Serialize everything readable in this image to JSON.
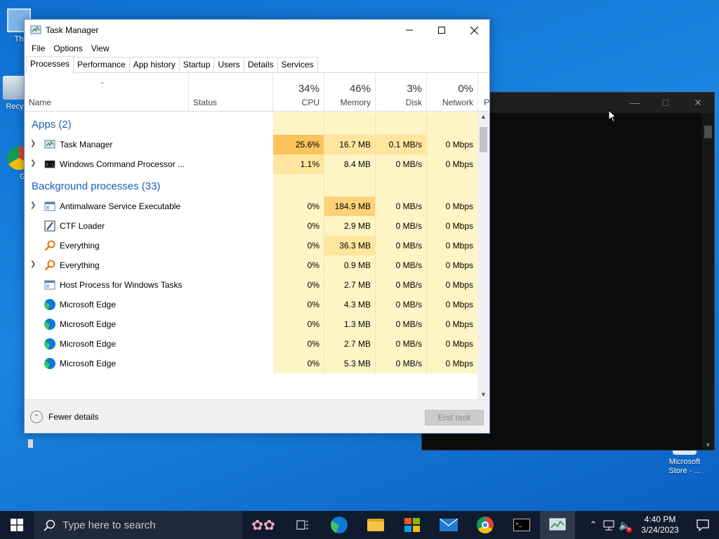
{
  "desktop": {
    "icons": [
      {
        "label": "Th"
      },
      {
        "label": "Recy"
      },
      {
        "label": "Go Ch"
      },
      {
        "label": "Microsoft Store - ..."
      }
    ]
  },
  "task_manager": {
    "title": "Task Manager",
    "menu": [
      "File",
      "Options",
      "View"
    ],
    "tabs": [
      "Processes",
      "Performance",
      "App history",
      "Startup",
      "Users",
      "Details",
      "Services"
    ],
    "active_tab": "Processes",
    "columns": {
      "name": "Name",
      "status": "Status",
      "cpu": {
        "pct": "34%",
        "label": "CPU"
      },
      "memory": {
        "pct": "46%",
        "label": "Memory"
      },
      "disk": {
        "pct": "3%",
        "label": "Disk"
      },
      "network": {
        "pct": "0%",
        "label": "Network"
      },
      "power_partial": "P"
    },
    "groups": {
      "apps": "Apps (2)",
      "background": "Background processes (33)"
    },
    "apps": [
      {
        "name": "Task Manager",
        "cpu": "25.6%",
        "memory": "16.7 MB",
        "disk": "0.1 MB/s",
        "network": "0 Mbps",
        "expandable": true,
        "icon": "task-manager-icon"
      },
      {
        "name": "Windows Command Processor ...",
        "cpu": "1.1%",
        "memory": "8.4 MB",
        "disk": "0 MB/s",
        "network": "0 Mbps",
        "expandable": true,
        "icon": "cmd-icon"
      }
    ],
    "background": [
      {
        "name": "Antimalware Service Executable",
        "cpu": "0%",
        "memory": "184.9 MB",
        "disk": "0 MB/s",
        "network": "0 Mbps",
        "expandable": true,
        "icon": "service-window-icon"
      },
      {
        "name": "CTF Loader",
        "cpu": "0%",
        "memory": "2.9 MB",
        "disk": "0 MB/s",
        "network": "0 Mbps",
        "expandable": false,
        "icon": "ctf-loader-icon"
      },
      {
        "name": "Everything",
        "cpu": "0%",
        "memory": "36.3 MB",
        "disk": "0 MB/s",
        "network": "0 Mbps",
        "expandable": false,
        "icon": "everything-search-icon"
      },
      {
        "name": "Everything",
        "cpu": "0%",
        "memory": "0.9 MB",
        "disk": "0 MB/s",
        "network": "0 Mbps",
        "expandable": true,
        "icon": "everything-search-icon"
      },
      {
        "name": "Host Process for Windows Tasks",
        "cpu": "0%",
        "memory": "2.7 MB",
        "disk": "0 MB/s",
        "network": "0 Mbps",
        "expandable": false,
        "icon": "service-window-icon"
      },
      {
        "name": "Microsoft Edge",
        "cpu": "0%",
        "memory": "4.3 MB",
        "disk": "0 MB/s",
        "network": "0 Mbps",
        "expandable": false,
        "icon": "edge-icon"
      },
      {
        "name": "Microsoft Edge",
        "cpu": "0%",
        "memory": "1.3 MB",
        "disk": "0 MB/s",
        "network": "0 Mbps",
        "expandable": false,
        "icon": "edge-icon"
      },
      {
        "name": "Microsoft Edge",
        "cpu": "0%",
        "memory": "2.7 MB",
        "disk": "0 MB/s",
        "network": "0 Mbps",
        "expandable": false,
        "icon": "edge-icon"
      },
      {
        "name": "Microsoft Edge",
        "cpu": "0%",
        "memory": "5.3 MB",
        "disk": "0 MB/s",
        "network": "0 Mbps",
        "expandable": false,
        "icon": "edge-icon"
      }
    ],
    "footer": {
      "fewer_details": "Fewer details",
      "end_task": "End task"
    }
  },
  "taskbar": {
    "search_placeholder": "Type here to search",
    "time": "4:40 PM",
    "date": "3/24/2023"
  },
  "colors": {
    "accent": "#1d5fb5",
    "heat_low": "#fff4c4",
    "heat_mid": "#ffe59e",
    "heat_high": "#fbc35c",
    "taskbar": "#101c2d"
  }
}
